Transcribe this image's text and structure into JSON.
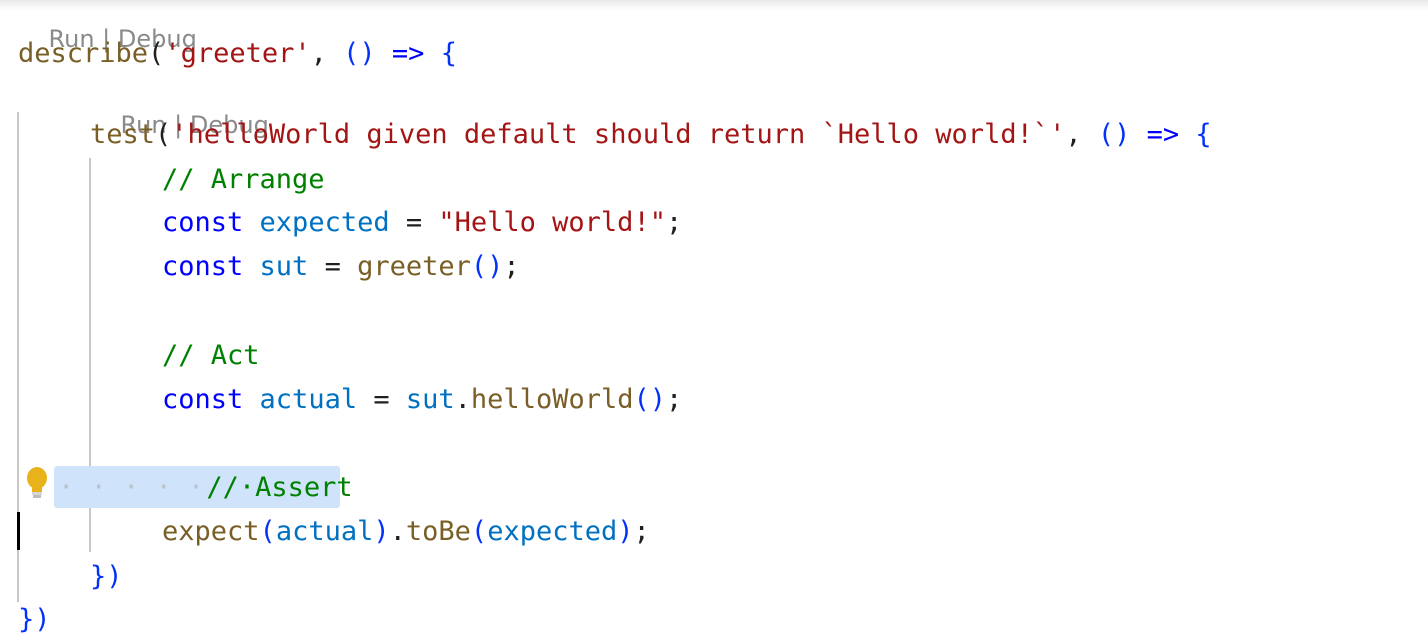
{
  "codelens": {
    "top": {
      "run": "Run",
      "sep": " | ",
      "debug": "Debug"
    },
    "inner": {
      "run": "Run",
      "sep": " | ",
      "debug": "Debug"
    }
  },
  "code": {
    "l1": {
      "fn": "describe",
      "open": "(",
      "str": "'greeter'",
      "comma": ", ",
      "paren": "()",
      "arrow": " => ",
      "brace": "{"
    },
    "l2": {
      "fn": "test",
      "open": "(",
      "str": "'helloWorld given default should return `Hello world!`'",
      "comma": ", ",
      "paren": "()",
      "arrow": " => ",
      "brace": "{"
    },
    "l3": {
      "comment": "// Arrange"
    },
    "l4": {
      "kw": "const",
      "var": "expected",
      "eq": " = ",
      "str": "\"Hello world!\"",
      "semi": ";"
    },
    "l5": {
      "kw": "const",
      "var": "sut",
      "eq": " = ",
      "fn": "greeter",
      "paren": "()",
      "semi": ";"
    },
    "l6": {
      "comment": "// Act"
    },
    "l7": {
      "kw": "const",
      "var": "actual",
      "eq": " = ",
      "obj": "sut",
      "dot": ".",
      "fn": "helloWorld",
      "paren": "()",
      "semi": ";"
    },
    "l8": {
      "dots": "· · · · ·",
      "comment": "//·Assert"
    },
    "l9": {
      "fn": "expect",
      "open": "(",
      "arg": "actual",
      "close": ")",
      "dot": ".",
      "fn2": "toBe",
      "open2": "(",
      "arg2": "expected",
      "close2": ")",
      "semi": ";"
    },
    "l10": {
      "close": "})"
    },
    "l11": {
      "close": "})"
    }
  }
}
